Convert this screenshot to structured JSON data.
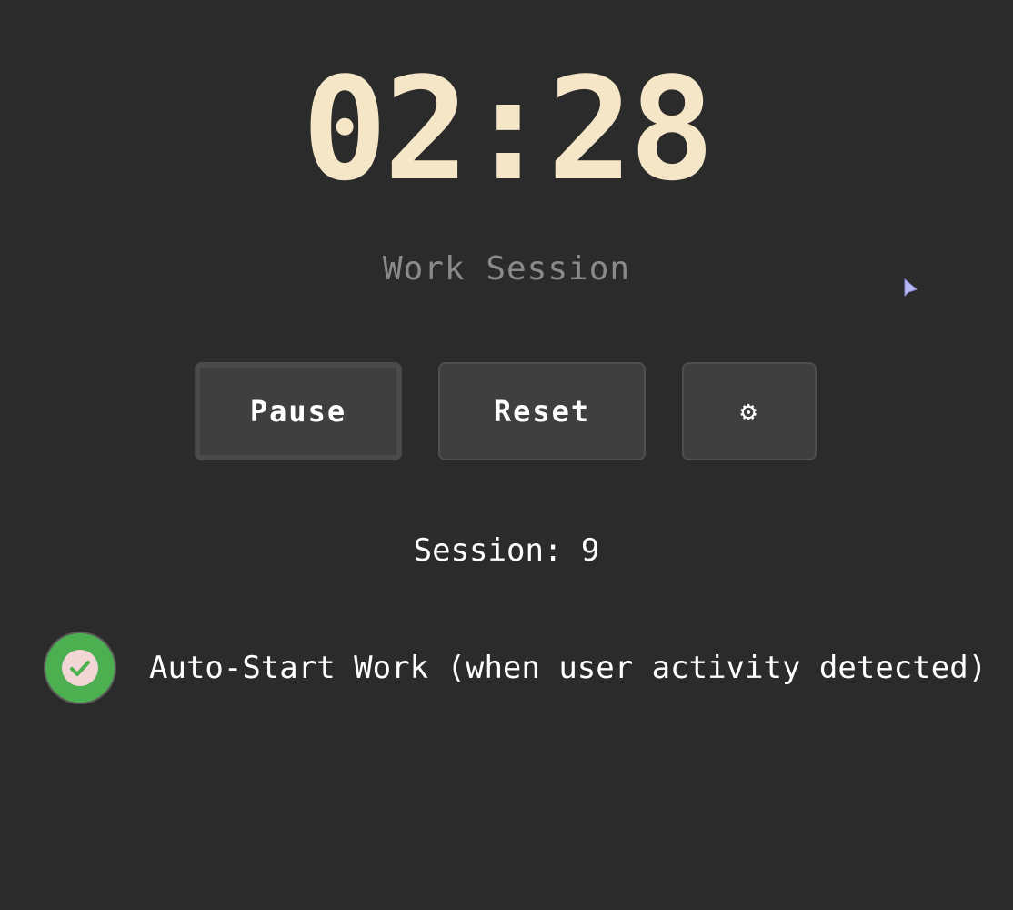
{
  "timer": {
    "display": "02:28",
    "color": "#f5e6c8"
  },
  "session_type": "Work Session",
  "controls": {
    "pause_label": "Pause",
    "reset_label": "Reset",
    "settings_icon": "gear-icon",
    "settings_glyph": "⚙"
  },
  "session_counter": {
    "text": "Session: 9"
  },
  "auto_start": {
    "label": "Auto-Start Work (when user activity detected)",
    "checked": true,
    "icon": "check-icon",
    "accent_color": "#4caf50"
  },
  "colors": {
    "background": "#2b2b2b",
    "button_bg": "#3f3f3f",
    "muted_text": "#8a8a8a"
  }
}
